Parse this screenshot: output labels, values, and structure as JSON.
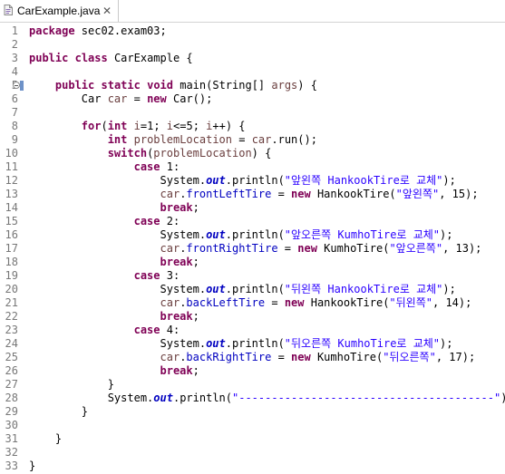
{
  "tab": {
    "title": "CarExample.java",
    "file_icon": "java-file-icon",
    "close_icon": "close-icon"
  },
  "colors": {
    "keyword": "#7f0055",
    "string": "#2a00ff",
    "field": "#0000c0",
    "local_var": "#6a3e3e",
    "line_number": "#787878"
  },
  "lines": [
    {
      "n": "1",
      "parts": [
        {
          "t": "package",
          "c": "kw"
        },
        {
          "t": " sec02.exam03;",
          "c": "pl"
        }
      ]
    },
    {
      "n": "2",
      "parts": []
    },
    {
      "n": "3",
      "parts": [
        {
          "t": "public",
          "c": "kw"
        },
        {
          "t": " ",
          "c": "pl"
        },
        {
          "t": "class",
          "c": "kw"
        },
        {
          "t": " CarExample {",
          "c": "pl"
        }
      ]
    },
    {
      "n": "4",
      "parts": []
    },
    {
      "n": "5",
      "fold": true,
      "parts": [
        {
          "t": "    ",
          "c": "pl"
        },
        {
          "t": "public",
          "c": "kw"
        },
        {
          "t": " ",
          "c": "pl"
        },
        {
          "t": "static",
          "c": "kw"
        },
        {
          "t": " ",
          "c": "pl"
        },
        {
          "t": "void",
          "c": "kw"
        },
        {
          "t": " main(String[] ",
          "c": "pl"
        },
        {
          "t": "args",
          "c": "var"
        },
        {
          "t": ") {",
          "c": "pl"
        }
      ]
    },
    {
      "n": "6",
      "parts": [
        {
          "t": "        Car ",
          "c": "pl"
        },
        {
          "t": "car",
          "c": "var"
        },
        {
          "t": " = ",
          "c": "pl"
        },
        {
          "t": "new",
          "c": "kw"
        },
        {
          "t": " Car();",
          "c": "pl"
        }
      ]
    },
    {
      "n": "7",
      "parts": []
    },
    {
      "n": "8",
      "parts": [
        {
          "t": "        ",
          "c": "pl"
        },
        {
          "t": "for",
          "c": "kw"
        },
        {
          "t": "(",
          "c": "pl"
        },
        {
          "t": "int",
          "c": "kw"
        },
        {
          "t": " ",
          "c": "pl"
        },
        {
          "t": "i",
          "c": "var"
        },
        {
          "t": "=1; ",
          "c": "pl"
        },
        {
          "t": "i",
          "c": "var"
        },
        {
          "t": "<=5; ",
          "c": "pl"
        },
        {
          "t": "i",
          "c": "var"
        },
        {
          "t": "++) {",
          "c": "pl"
        }
      ]
    },
    {
      "n": "9",
      "parts": [
        {
          "t": "            ",
          "c": "pl"
        },
        {
          "t": "int",
          "c": "kw"
        },
        {
          "t": " ",
          "c": "pl"
        },
        {
          "t": "problemLocation",
          "c": "var"
        },
        {
          "t": " = ",
          "c": "pl"
        },
        {
          "t": "car",
          "c": "var"
        },
        {
          "t": ".run();",
          "c": "pl"
        }
      ]
    },
    {
      "n": "10",
      "parts": [
        {
          "t": "            ",
          "c": "pl"
        },
        {
          "t": "switch",
          "c": "kw"
        },
        {
          "t": "(",
          "c": "pl"
        },
        {
          "t": "problemLocation",
          "c": "var"
        },
        {
          "t": ") {",
          "c": "pl"
        }
      ]
    },
    {
      "n": "11",
      "parts": [
        {
          "t": "                ",
          "c": "pl"
        },
        {
          "t": "case",
          "c": "kw"
        },
        {
          "t": " 1:",
          "c": "pl"
        }
      ]
    },
    {
      "n": "12",
      "parts": [
        {
          "t": "                    System.",
          "c": "pl"
        },
        {
          "t": "out",
          "c": "sfld"
        },
        {
          "t": ".println(",
          "c": "pl"
        },
        {
          "t": "\"앞왼쪽 HankookTire로 교체\"",
          "c": "str"
        },
        {
          "t": ");",
          "c": "pl"
        }
      ]
    },
    {
      "n": "13",
      "parts": [
        {
          "t": "                    ",
          "c": "pl"
        },
        {
          "t": "car",
          "c": "var"
        },
        {
          "t": ".",
          "c": "pl"
        },
        {
          "t": "frontLeftTire",
          "c": "fld"
        },
        {
          "t": " = ",
          "c": "pl"
        },
        {
          "t": "new",
          "c": "kw"
        },
        {
          "t": " HankookTire(",
          "c": "pl"
        },
        {
          "t": "\"앞왼쪽\"",
          "c": "str"
        },
        {
          "t": ", 15);",
          "c": "pl"
        }
      ]
    },
    {
      "n": "14",
      "parts": [
        {
          "t": "                    ",
          "c": "pl"
        },
        {
          "t": "break",
          "c": "kw"
        },
        {
          "t": ";",
          "c": "pl"
        }
      ]
    },
    {
      "n": "15",
      "parts": [
        {
          "t": "                ",
          "c": "pl"
        },
        {
          "t": "case",
          "c": "kw"
        },
        {
          "t": " 2:",
          "c": "pl"
        }
      ]
    },
    {
      "n": "16",
      "parts": [
        {
          "t": "                    System.",
          "c": "pl"
        },
        {
          "t": "out",
          "c": "sfld"
        },
        {
          "t": ".println(",
          "c": "pl"
        },
        {
          "t": "\"앞오른쪽 KumhoTire로 교체\"",
          "c": "str"
        },
        {
          "t": ");",
          "c": "pl"
        }
      ]
    },
    {
      "n": "17",
      "parts": [
        {
          "t": "                    ",
          "c": "pl"
        },
        {
          "t": "car",
          "c": "var"
        },
        {
          "t": ".",
          "c": "pl"
        },
        {
          "t": "frontRightTire",
          "c": "fld"
        },
        {
          "t": " = ",
          "c": "pl"
        },
        {
          "t": "new",
          "c": "kw"
        },
        {
          "t": " KumhoTire(",
          "c": "pl"
        },
        {
          "t": "\"앞오른쪽\"",
          "c": "str"
        },
        {
          "t": ", 13);",
          "c": "pl"
        }
      ]
    },
    {
      "n": "18",
      "parts": [
        {
          "t": "                    ",
          "c": "pl"
        },
        {
          "t": "break",
          "c": "kw"
        },
        {
          "t": ";",
          "c": "pl"
        }
      ]
    },
    {
      "n": "19",
      "parts": [
        {
          "t": "                ",
          "c": "pl"
        },
        {
          "t": "case",
          "c": "kw"
        },
        {
          "t": " 3:",
          "c": "pl"
        }
      ]
    },
    {
      "n": "20",
      "parts": [
        {
          "t": "                    System.",
          "c": "pl"
        },
        {
          "t": "out",
          "c": "sfld"
        },
        {
          "t": ".println(",
          "c": "pl"
        },
        {
          "t": "\"뒤왼쪽 HankookTire로 교체\"",
          "c": "str"
        },
        {
          "t": ");",
          "c": "pl"
        }
      ]
    },
    {
      "n": "21",
      "parts": [
        {
          "t": "                    ",
          "c": "pl"
        },
        {
          "t": "car",
          "c": "var"
        },
        {
          "t": ".",
          "c": "pl"
        },
        {
          "t": "backLeftTire",
          "c": "fld"
        },
        {
          "t": " = ",
          "c": "pl"
        },
        {
          "t": "new",
          "c": "kw"
        },
        {
          "t": " HankookTire(",
          "c": "pl"
        },
        {
          "t": "\"뒤왼쪽\"",
          "c": "str"
        },
        {
          "t": ", 14);",
          "c": "pl"
        }
      ]
    },
    {
      "n": "22",
      "parts": [
        {
          "t": "                    ",
          "c": "pl"
        },
        {
          "t": "break",
          "c": "kw"
        },
        {
          "t": ";",
          "c": "pl"
        }
      ]
    },
    {
      "n": "23",
      "parts": [
        {
          "t": "                ",
          "c": "pl"
        },
        {
          "t": "case",
          "c": "kw"
        },
        {
          "t": " 4:",
          "c": "pl"
        }
      ]
    },
    {
      "n": "24",
      "parts": [
        {
          "t": "                    System.",
          "c": "pl"
        },
        {
          "t": "out",
          "c": "sfld"
        },
        {
          "t": ".println(",
          "c": "pl"
        },
        {
          "t": "\"뒤오른쪽 KumhoTire로 교체\"",
          "c": "str"
        },
        {
          "t": ");",
          "c": "pl"
        }
      ]
    },
    {
      "n": "25",
      "parts": [
        {
          "t": "                    ",
          "c": "pl"
        },
        {
          "t": "car",
          "c": "var"
        },
        {
          "t": ".",
          "c": "pl"
        },
        {
          "t": "backRightTire",
          "c": "fld"
        },
        {
          "t": " = ",
          "c": "pl"
        },
        {
          "t": "new",
          "c": "kw"
        },
        {
          "t": " KumhoTire(",
          "c": "pl"
        },
        {
          "t": "\"뒤오른쪽\"",
          "c": "str"
        },
        {
          "t": ", 17);",
          "c": "pl"
        }
      ]
    },
    {
      "n": "26",
      "parts": [
        {
          "t": "                    ",
          "c": "pl"
        },
        {
          "t": "break",
          "c": "kw"
        },
        {
          "t": ";",
          "c": "pl"
        }
      ]
    },
    {
      "n": "27",
      "parts": [
        {
          "t": "            }",
          "c": "pl"
        }
      ]
    },
    {
      "n": "28",
      "parts": [
        {
          "t": "            System.",
          "c": "pl"
        },
        {
          "t": "out",
          "c": "sfld"
        },
        {
          "t": ".println(",
          "c": "pl"
        },
        {
          "t": "\"---------------------------------------\"",
          "c": "str"
        },
        {
          "t": ");",
          "c": "pl"
        }
      ]
    },
    {
      "n": "29",
      "parts": [
        {
          "t": "        }",
          "c": "pl"
        }
      ]
    },
    {
      "n": "30",
      "parts": []
    },
    {
      "n": "31",
      "parts": [
        {
          "t": "    }",
          "c": "pl"
        }
      ]
    },
    {
      "n": "32",
      "parts": []
    },
    {
      "n": "33",
      "parts": [
        {
          "t": "}",
          "c": "pl"
        }
      ]
    }
  ]
}
